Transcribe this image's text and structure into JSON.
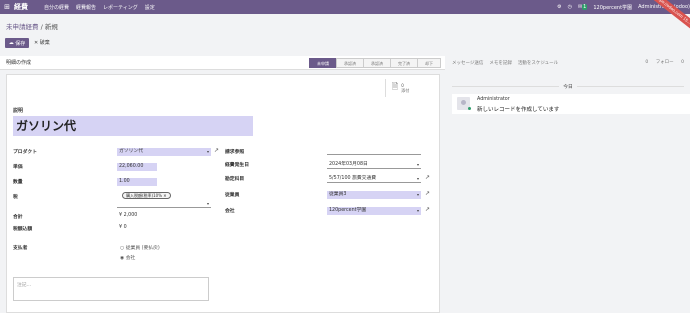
{
  "topbar": {
    "grid_icon": "⊞",
    "app_name": "経費",
    "menu": [
      "自分の経費",
      "経費報告",
      "レポーティング",
      "設定"
    ],
    "company": "120percent学園",
    "user": "Administrator (odoo)",
    "chat_count": "1"
  },
  "ribbon": "https://odoo.com 15...",
  "breadcrumb": {
    "parent": "未申請経費",
    "current": "新規"
  },
  "buttons": {
    "save": "保存",
    "discard": "破棄"
  },
  "statusbar": {
    "create_report": "明細の作成",
    "stages": [
      "未申請",
      "承認済",
      "承認済",
      "完了済",
      "却下"
    ],
    "active_stage": 0
  },
  "chatter_tabs": {
    "send": "メッセージ送信",
    "note": "メモを記録",
    "schedule": "活動をスケジュール",
    "followers": "0",
    "follow": "フォロー",
    "people": "0"
  },
  "smart_button": {
    "count": "0",
    "label": "添付"
  },
  "form": {
    "title_label": "説明",
    "title": "ガソリン代",
    "product_label": "プロダクト",
    "product_value": "ガソリン代",
    "unit_price_label": "単価",
    "unit_price_value": "22,060.00",
    "quantity_label": "数量",
    "quantity_value": "1.00",
    "tax_label": "税",
    "tax_tag": "購入税額(税率)10%",
    "total_label": "合計",
    "total_value": "¥ 2,000",
    "tax_amount_label": "税額込額",
    "tax_amount_value": "¥ 0",
    "paid_by_label": "支払者",
    "paid_by_options": [
      "従業員 (要払戻)",
      "会社"
    ],
    "paid_by_selected": 1,
    "reference_label": "請求参照",
    "date_label": "経費発生日",
    "date_value": "2024年03月08日",
    "account_label": "勘定科目",
    "account_value": "5/57/100 旅費交通費",
    "employee_label": "従業員",
    "employee_value": "従業員3",
    "company_label": "会社",
    "company_value": "120percent学園",
    "notes_placeholder": "注記..."
  },
  "chatter": {
    "today": "今日",
    "author": "Administrator",
    "message": "新しいレコードを作成しています"
  }
}
